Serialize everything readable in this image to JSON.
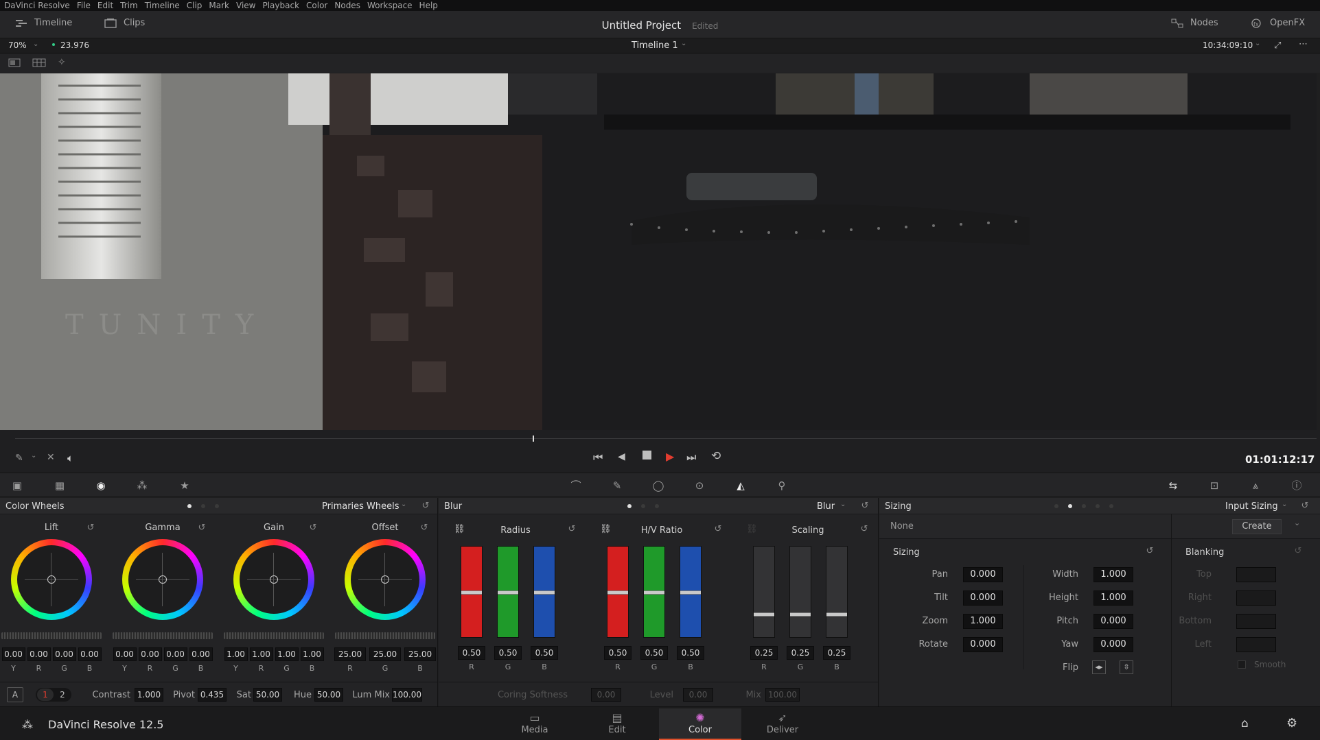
{
  "menu": [
    "DaVinci Resolve",
    "File",
    "Edit",
    "Trim",
    "Timeline",
    "Clip",
    "Mark",
    "View",
    "Playback",
    "Color",
    "Nodes",
    "Workspace",
    "Help"
  ],
  "topbar": {
    "timeline_label": "Timeline",
    "clips_label": "Clips",
    "project_title": "Untitled Project",
    "edited_label": "Edited",
    "nodes_label": "Nodes",
    "openfx_label": "OpenFX"
  },
  "viewer": {
    "zoom": "70%",
    "fps": "23.976",
    "timeline_name": "Timeline 1",
    "source_timecode": "10:34:09:10",
    "record_timecode": "01:01:12:17",
    "frame_text": "TUNITY"
  },
  "color_wheels": {
    "title": "Color Wheels",
    "mode": "Primaries Wheels",
    "wheels": [
      {
        "label": "Lift",
        "values": [
          "0.00",
          "0.00",
          "0.00",
          "0.00"
        ],
        "channels": [
          "Y",
          "R",
          "G",
          "B"
        ]
      },
      {
        "label": "Gamma",
        "values": [
          "0.00",
          "0.00",
          "0.00",
          "0.00"
        ],
        "channels": [
          "Y",
          "R",
          "G",
          "B"
        ]
      },
      {
        "label": "Gain",
        "values": [
          "1.00",
          "1.00",
          "1.00",
          "1.00"
        ],
        "channels": [
          "Y",
          "R",
          "G",
          "B"
        ]
      },
      {
        "label": "Offset",
        "values": [
          "25.00",
          "25.00",
          "25.00"
        ],
        "channels": [
          "R",
          "G",
          "B"
        ]
      }
    ],
    "footer": {
      "a_label": "A",
      "page1": "1",
      "page2": "2",
      "contrast_label": "Contrast",
      "contrast": "1.000",
      "pivot_label": "Pivot",
      "pivot": "0.435",
      "sat_label": "Sat",
      "sat": "50.00",
      "hue_label": "Hue",
      "hue": "50.00",
      "lummix_label": "Lum Mix",
      "lummix": "100.00"
    }
  },
  "blur": {
    "title": "Blur",
    "mode": "Blur",
    "groups": [
      {
        "label": "Radius",
        "values": [
          "0.50",
          "0.50",
          "0.50"
        ],
        "channels": [
          "R",
          "G",
          "B"
        ]
      },
      {
        "label": "H/V Ratio",
        "values": [
          "0.50",
          "0.50",
          "0.50"
        ],
        "channels": [
          "R",
          "G",
          "B"
        ]
      },
      {
        "label": "Scaling",
        "values": [
          "0.25",
          "0.25",
          "0.25"
        ],
        "channels": [
          "R",
          "G",
          "B"
        ]
      }
    ],
    "footer": {
      "coring_label": "Coring Softness",
      "coring": "0.00",
      "level_label": "Level",
      "level": "0.00",
      "mix_label": "Mix",
      "mix": "100.00"
    }
  },
  "sizing": {
    "title": "Sizing",
    "mode": "Input Sizing",
    "preset": "None",
    "create_label": "Create",
    "section_label": "Sizing",
    "left_fields": [
      {
        "label": "Pan",
        "value": "0.000"
      },
      {
        "label": "Tilt",
        "value": "0.000"
      },
      {
        "label": "Zoom",
        "value": "1.000"
      },
      {
        "label": "Rotate",
        "value": "0.000"
      }
    ],
    "right_fields": [
      {
        "label": "Width",
        "value": "1.000"
      },
      {
        "label": "Height",
        "value": "1.000"
      },
      {
        "label": "Pitch",
        "value": "0.000"
      },
      {
        "label": "Yaw",
        "value": "0.000"
      }
    ],
    "flip_label": "Flip",
    "blanking": {
      "title": "Blanking",
      "fields": [
        "Top",
        "Right",
        "Bottom",
        "Left"
      ],
      "smooth_label": "Smooth"
    }
  },
  "bottombar": {
    "app_name": "DaVinci Resolve 12.5",
    "pages": [
      {
        "label": "Media",
        "icon": "media-icon"
      },
      {
        "label": "Edit",
        "icon": "edit-icon"
      },
      {
        "label": "Color",
        "icon": "color-icon"
      },
      {
        "label": "Deliver",
        "icon": "deliver-icon"
      }
    ],
    "active_page": "Color"
  },
  "colors": {
    "accent_play": "#e23c2f",
    "active_tab_underline": "#e0512c",
    "bar_red": "#d41f1f",
    "bar_green": "#1f9a2a",
    "bar_blue": "#1e4fae"
  }
}
